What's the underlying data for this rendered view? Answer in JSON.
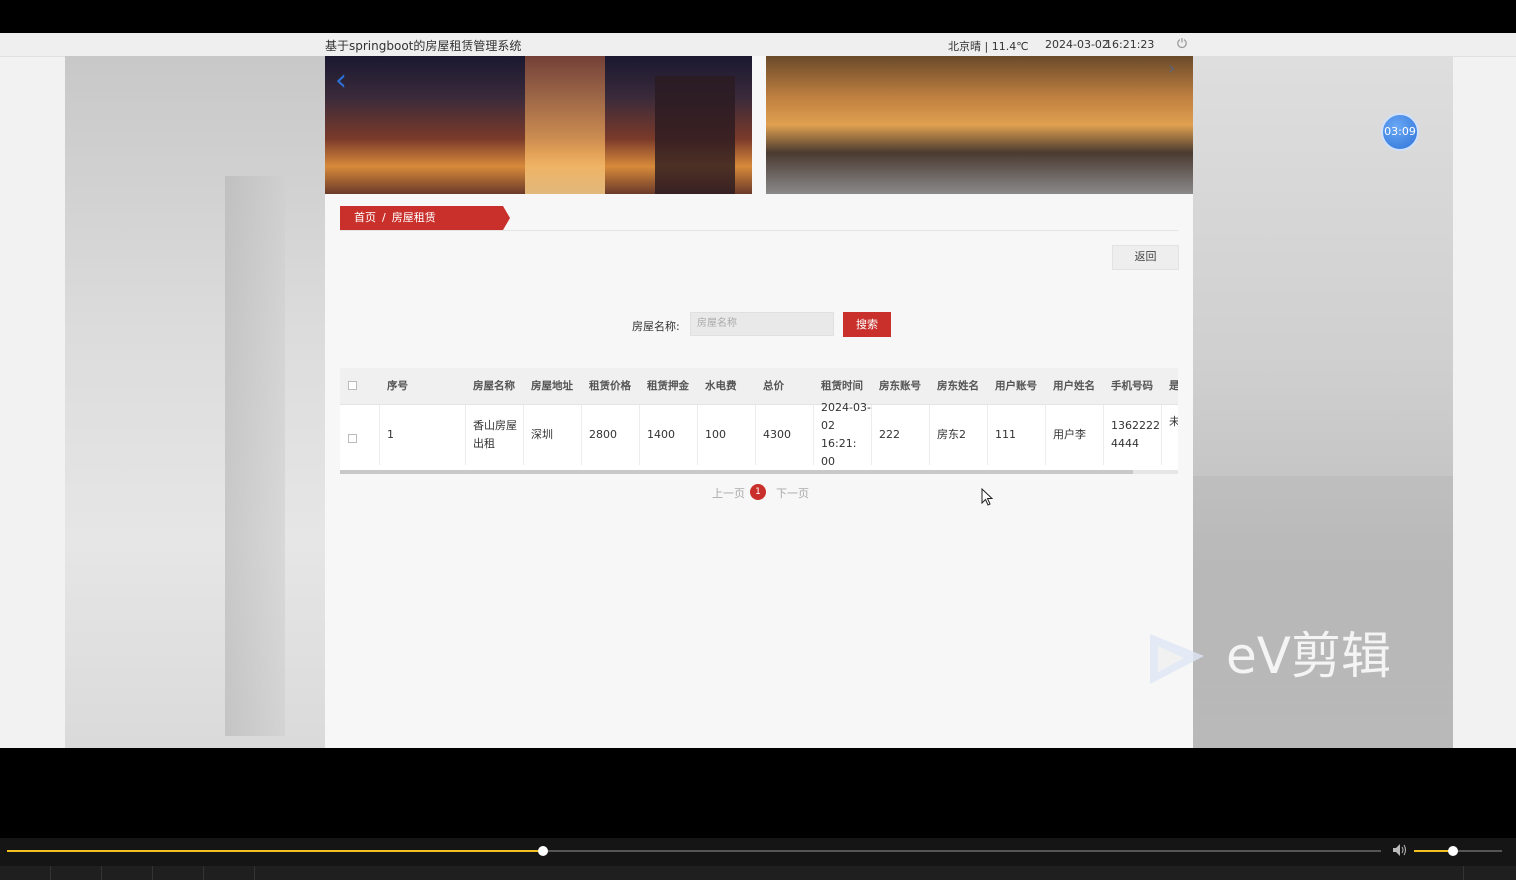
{
  "topbar": {
    "title": "基于springboot的房屋租赁管理系统",
    "weather": "北京晴 | 11.4℃",
    "date": "2024-03-02",
    "time": "16:21:23",
    "power_icon": "power-icon"
  },
  "breadcrumb": {
    "home": "首页",
    "sep": "/",
    "current": "房屋租赁"
  },
  "back_button": "返回",
  "search": {
    "label": "房屋名称:",
    "placeholder": "房屋名称",
    "button": "搜索"
  },
  "table": {
    "headers": [
      "序号",
      "房屋名称",
      "房屋地址",
      "租赁价格",
      "租赁押金",
      "水电费",
      "总价",
      "租赁时间",
      "房东账号",
      "房东姓名",
      "用户账号",
      "用户姓名",
      "手机号码",
      "是"
    ],
    "rows": [
      {
        "index": "1",
        "name_l1": "香山房屋",
        "name_l2": "出租",
        "address": "深圳",
        "price": "2800",
        "deposit": "1400",
        "utility": "100",
        "total": "4300",
        "time_l1": "2024-03-",
        "time_l2": "02 16:21:",
        "time_l3": "00",
        "landlord_account": "222",
        "landlord_name": "房东2",
        "user_account": "111",
        "user_name": "用户李",
        "phone_l1": "1362222",
        "phone_l2": "4444",
        "status_partial": "未"
      }
    ]
  },
  "pagination": {
    "prev": "上一页",
    "current": "1",
    "next": "下一页"
  },
  "timer": "03:09",
  "watermark": "eV剪辑",
  "player": {
    "progress": 0.39,
    "volume": 0.44
  },
  "colors": {
    "accent": "#c9302c",
    "timer": "#2e73d8",
    "seek": "#f0c020"
  }
}
